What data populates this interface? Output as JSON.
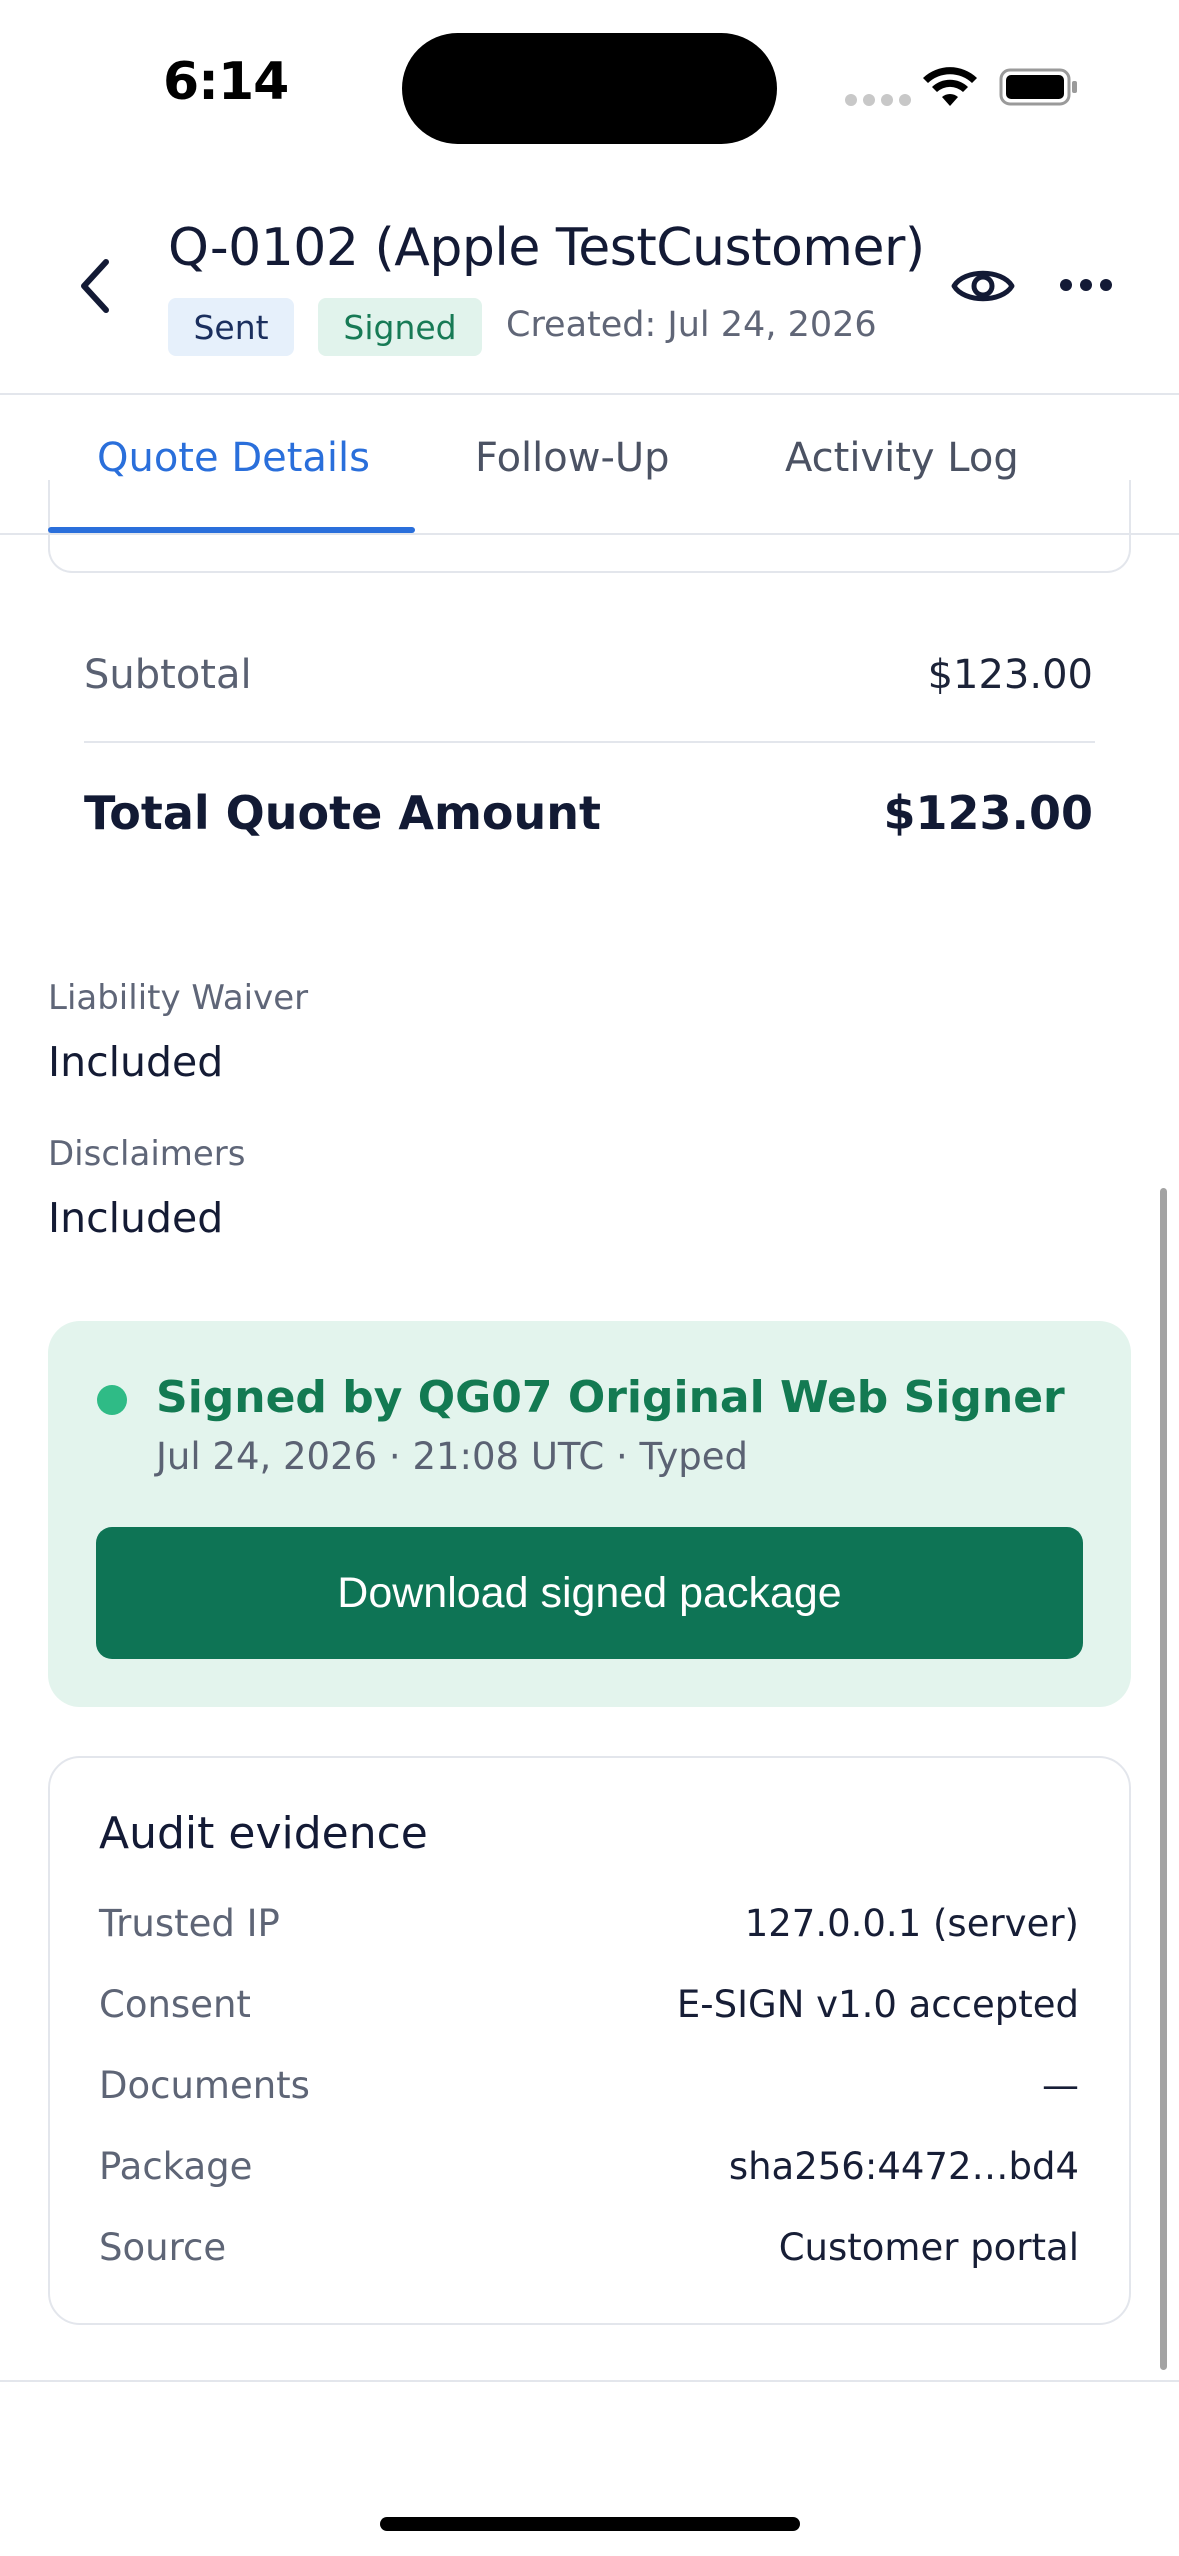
{
  "status_bar": {
    "time": "6:14"
  },
  "header": {
    "title": "Q-0102 (Apple TestCustomer)",
    "badges": {
      "sent": "Sent",
      "signed": "Signed"
    },
    "created": "Created: Jul 24, 2026"
  },
  "tabs": [
    {
      "label": "Quote Details",
      "active": true
    },
    {
      "label": "Follow-Up",
      "active": false
    },
    {
      "label": "Activity Log",
      "active": false
    }
  ],
  "totals": {
    "subtotal_label": "Subtotal",
    "subtotal_value": "$123.00",
    "total_label": "Total Quote Amount",
    "total_value": "$123.00"
  },
  "fields": {
    "liability_label": "Liability Waiver",
    "liability_value": "Included",
    "disclaimers_label": "Disclaimers",
    "disclaimers_value": "Included"
  },
  "signature": {
    "title": "Signed by QG07 Original Web Signer",
    "meta": "Jul 24, 2026 · 21:08 UTC · Typed",
    "download_label": "Download signed package"
  },
  "audit": {
    "title": "Audit evidence",
    "rows": [
      {
        "label": "Trusted IP",
        "value": "127.0.0.1 (server)"
      },
      {
        "label": "Consent",
        "value": "E-SIGN v1.0 accepted"
      },
      {
        "label": "Documents",
        "value": "—"
      },
      {
        "label": "Package",
        "value": "sha256:4472…bd4"
      },
      {
        "label": "Source",
        "value": "Customer portal"
      }
    ]
  },
  "colors": {
    "accent": "#2a6fdb",
    "success": "#137a52",
    "button": "#0e7455",
    "signed_panel": "#e3f4ed"
  }
}
